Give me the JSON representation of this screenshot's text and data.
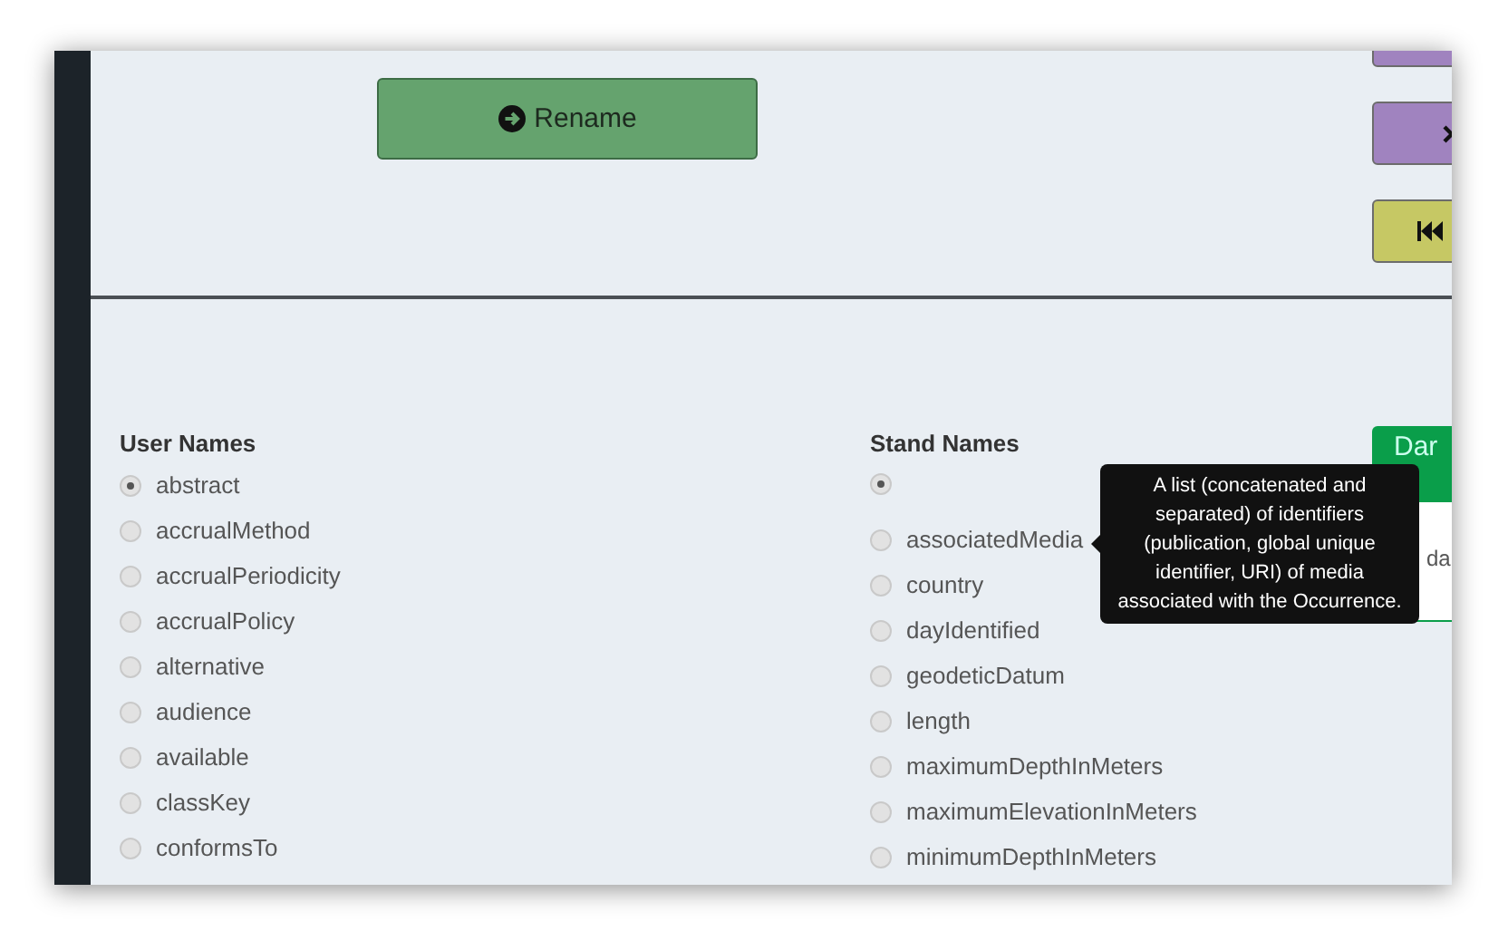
{
  "rename_button": {
    "label": "Rename"
  },
  "side_buttons": [
    {
      "kind": "plain",
      "color": "#a083bf"
    },
    {
      "kind": "close",
      "color": "#a083bf"
    },
    {
      "kind": "first",
      "color": "#c6c864"
    }
  ],
  "user_names": {
    "heading": "User Names",
    "items": [
      {
        "label": "abstract",
        "selected": true
      },
      {
        "label": "accrualMethod",
        "selected": false
      },
      {
        "label": "accrualPeriodicity",
        "selected": false
      },
      {
        "label": "accrualPolicy",
        "selected": false
      },
      {
        "label": "alternative",
        "selected": false
      },
      {
        "label": "audience",
        "selected": false
      },
      {
        "label": "available",
        "selected": false
      },
      {
        "label": "classKey",
        "selected": false
      },
      {
        "label": "conformsTo",
        "selected": false
      }
    ]
  },
  "stand_names": {
    "heading": "Stand Names",
    "items": [
      {
        "selected": true
      },
      {
        "label": "associatedMedia",
        "selected": false
      },
      {
        "label": "country",
        "selected": false
      },
      {
        "label": "dayIdentified",
        "selected": false
      },
      {
        "label": "geodeticDatum",
        "selected": false
      },
      {
        "label": "length",
        "selected": false
      },
      {
        "label": "maximumDepthInMeters",
        "selected": false
      },
      {
        "label": "maximumElevationInMeters",
        "selected": false
      },
      {
        "label": "minimumDepthInMeters",
        "selected": false
      }
    ]
  },
  "tooltip": {
    "text": "A list (concatenated and separated) of identifiers (publication, global unique identifier, URI) of media associated with the Occurrence."
  },
  "side_panel": {
    "button": "Dar",
    "text": "da"
  }
}
